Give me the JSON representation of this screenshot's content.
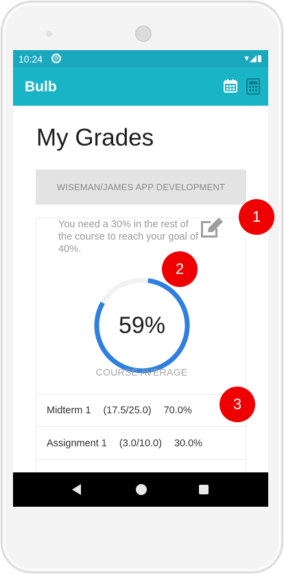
{
  "status_bar": {
    "time": "10:24",
    "sync_glyph": "@",
    "icons": "▾◢▮"
  },
  "app_bar": {
    "title": "Bulb",
    "calendar_icon": "calendar-icon",
    "calculator_icon": "calculator-icon"
  },
  "page": {
    "title": "My Grades",
    "course": "WISEMAN/JAMES APP DEVELOPMENT",
    "goal_message": "You need a 30% in the rest of the course to reach your goal of 40%.",
    "course_average": {
      "value_text": "59%",
      "fraction": 0.59,
      "label": "COURSE AVERAGE"
    },
    "grades": [
      {
        "name": "Midterm 1",
        "score": "(17.5/25.0)",
        "percent": "70.0%"
      },
      {
        "name": "Assignment 1",
        "score": "(3.0/10.0)",
        "percent": "30.0%"
      }
    ]
  },
  "colors": {
    "status_bar": "#1aa8bf",
    "app_bar": "#19b4c6",
    "gauge": "#2f7fe0",
    "marker": "#ee0000"
  },
  "markers": [
    "1",
    "2",
    "3"
  ]
}
